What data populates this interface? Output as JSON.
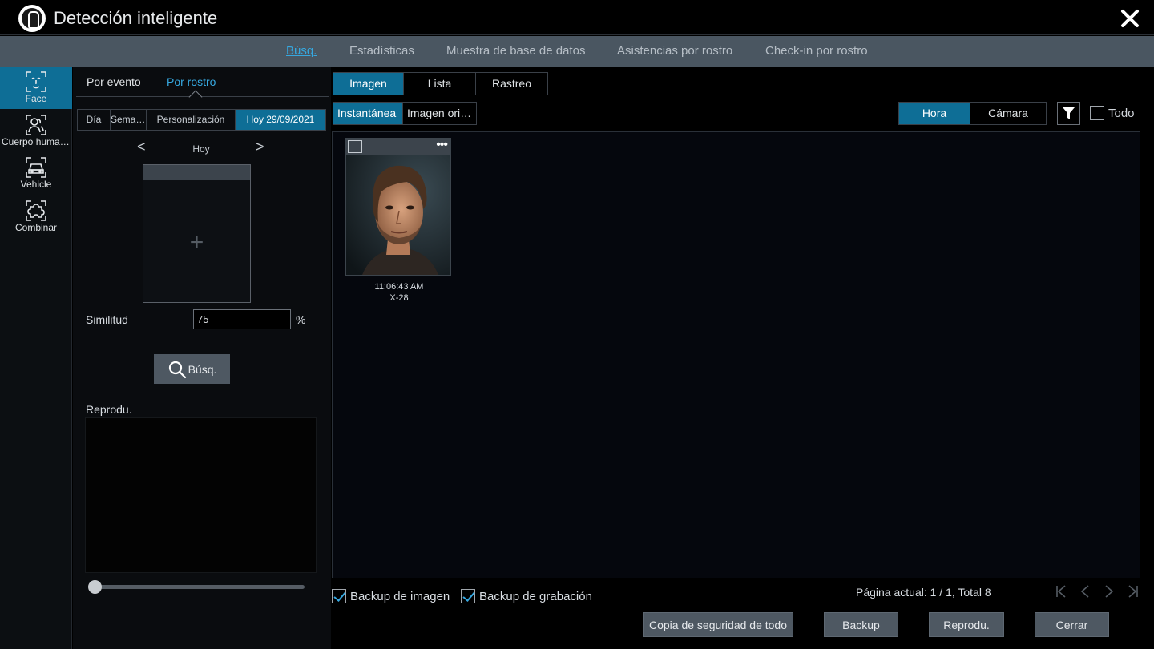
{
  "window": {
    "title": "Detección inteligente"
  },
  "topnav": {
    "items": [
      {
        "label": "Búsq.",
        "active": true
      },
      {
        "label": "Estadísticas"
      },
      {
        "label": "Muestra de base de datos"
      },
      {
        "label": "Asistencias por rostro"
      },
      {
        "label": "Check-in por rostro"
      }
    ]
  },
  "sidebar": {
    "items": [
      {
        "label": "Face",
        "icon": "face-scan-icon",
        "active": true
      },
      {
        "label": "Cuerpo humano",
        "icon": "human-body-icon"
      },
      {
        "label": "Vehicle",
        "icon": "vehicle-icon"
      },
      {
        "label": "Combinar",
        "icon": "puzzle-icon"
      }
    ]
  },
  "left_panel": {
    "tabs": [
      {
        "label": "Por evento"
      },
      {
        "label": "Por rostro",
        "active": true
      }
    ],
    "date_range": [
      {
        "label": "Día"
      },
      {
        "label": "Semana"
      },
      {
        "label": "Personalización"
      },
      {
        "label": "Hoy 29/09/2021",
        "active": true
      }
    ],
    "day_nav": {
      "prev": "<",
      "label": "Hoy",
      "next": ">"
    },
    "face_box": {
      "add_symbol": "+"
    },
    "similarity": {
      "label": "Similitud",
      "value": "75",
      "unit": "%"
    },
    "search_button": "Búsq.",
    "playback_label": "Reprodu.",
    "playback_position": 0
  },
  "right_panel": {
    "view_tabs": [
      {
        "label": "Imagen",
        "active": true
      },
      {
        "label": "Lista"
      },
      {
        "label": "Rastreo"
      }
    ],
    "image_tabs": [
      {
        "label": "Instantánea",
        "active": true
      },
      {
        "label": "Imagen original"
      }
    ],
    "sort_tabs": [
      {
        "label": "Hora",
        "active": true
      },
      {
        "label": "Cámara"
      }
    ],
    "select_all_label": "Todo",
    "results": [
      {
        "time": "11:06:43 AM",
        "camera": "X-28",
        "more": "•••"
      }
    ],
    "backup_image": {
      "label": "Backup de imagen",
      "checked": true
    },
    "backup_recording": {
      "label": "Backup de grabación",
      "checked": true
    },
    "page_info": "Página actual: 1 / 1, Total 8"
  },
  "footer": {
    "buttons": {
      "backup_all": "Copia de seguridad de todo",
      "backup": "Backup",
      "playback": "Reprodu.",
      "close": "Cerrar"
    }
  },
  "colors": {
    "accent": "#0e6e96",
    "link": "#36a8e0",
    "nav_bg": "#4a5661",
    "button_bg": "#4e5862"
  }
}
